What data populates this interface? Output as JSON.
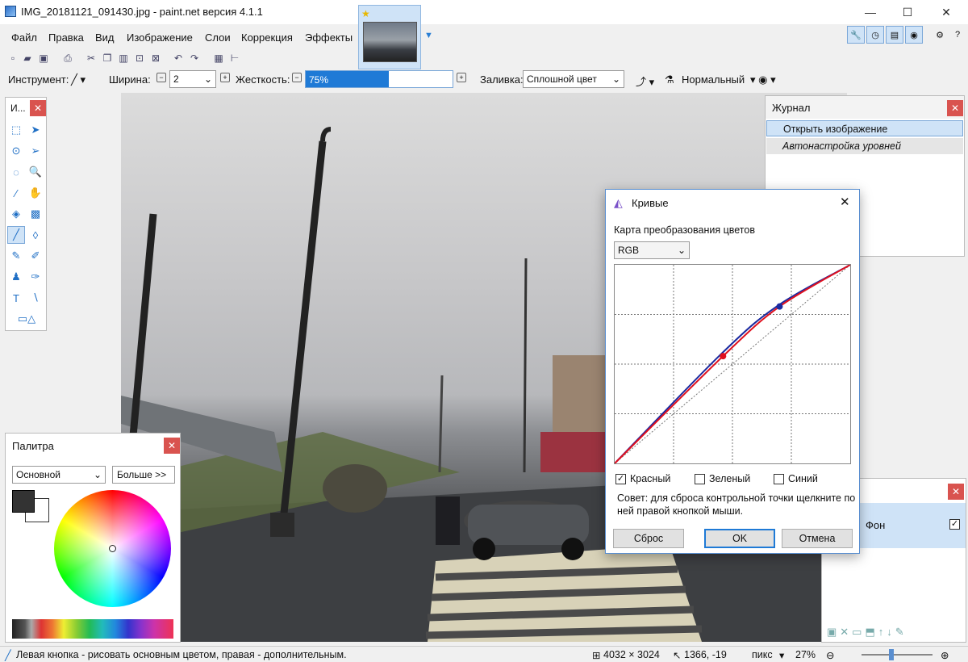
{
  "window": {
    "title": "IMG_20181121_091430.jpg - paint.net версия 4.1.1",
    "minimize": "—",
    "maximize": "☐",
    "close": "✕"
  },
  "menu": [
    "Файл",
    "Правка",
    "Вид",
    "Изображение",
    "Слои",
    "Коррекция",
    "Эффекты"
  ],
  "toolbar2": {
    "tool_label": "Инструмент:",
    "width_label": "Ширина:",
    "width_value": "2",
    "hardness_label": "Жесткость:",
    "hardness_value": "75%",
    "hardness_percent": 75,
    "fill_label": "Заливка:",
    "fill_value": "Сплошной цвет",
    "blend_value": "Нормальный"
  },
  "tools_panel": {
    "title": "И...",
    "close": "✕"
  },
  "history": {
    "title": "Журнал",
    "close": "✕",
    "items": [
      "Открыть изображение",
      "Автонастройка уровней"
    ]
  },
  "palette": {
    "title": "Палитра",
    "close": "✕",
    "mode": "Основной",
    "more": "Больше >>"
  },
  "layers": {
    "close": "✕",
    "layer_name": "Фон"
  },
  "curves": {
    "title": "Кривые",
    "close": "✕",
    "map_label": "Карта преобразования цветов",
    "mode": "RGB",
    "channels": [
      {
        "label": "Красный",
        "checked": true
      },
      {
        "label": "Зеленый",
        "checked": false
      },
      {
        "label": "Синий",
        "checked": false
      }
    ],
    "hint": "Совет: для сброса контрольной точки щелкните по ней правой кнопкой мыши.",
    "reset": "Сброс",
    "ok": "OK",
    "cancel": "Отмена",
    "curve_red": [
      [
        0,
        0
      ],
      [
        0.46,
        0.54
      ],
      [
        0.7,
        0.79
      ],
      [
        1,
        1
      ]
    ],
    "curve_blue": [
      [
        0,
        0
      ],
      [
        0.46,
        0.56
      ],
      [
        0.7,
        0.8
      ],
      [
        1,
        1
      ]
    ],
    "points_red": [
      [
        0.46,
        0.54
      ]
    ],
    "points_blue": [
      [
        0.7,
        0.79
      ]
    ],
    "red_color": "#e0101e",
    "blue_color": "#1a2aa0"
  },
  "status": {
    "hint": "Левая кнопка - рисовать основным цветом, правая - дополнительным.",
    "size": "4032 × 3024",
    "coords": "1366, -19",
    "unit": "пикс",
    "zoom": "27%"
  }
}
